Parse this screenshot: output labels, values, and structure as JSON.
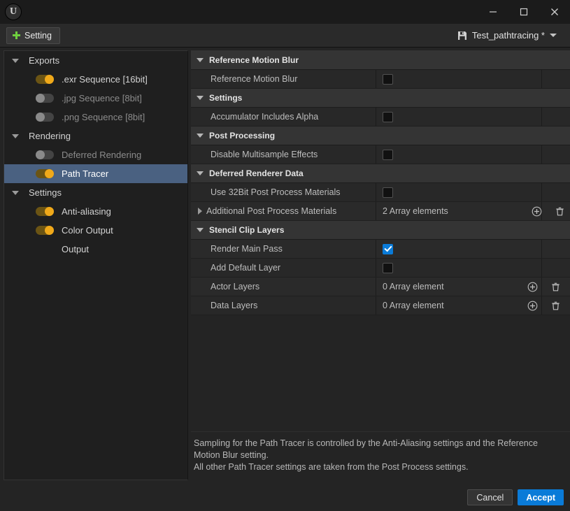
{
  "window": {
    "logo_glyph": "U",
    "minimize_label": "Minimize",
    "maximize_label": "Maximize",
    "close_label": "Close"
  },
  "toolbar": {
    "setting_button_label": "Setting",
    "preset_name": "Test_pathtracing *"
  },
  "sidebar": {
    "groups": [
      {
        "label": "Exports",
        "items": [
          {
            "label": ".exr Sequence [16bit]",
            "toggle": "on",
            "state": "enabled",
            "selected": false
          },
          {
            "label": ".jpg Sequence [8bit]",
            "toggle": "off",
            "state": "disabled",
            "selected": false
          },
          {
            "label": ".png Sequence [8bit]",
            "toggle": "off",
            "state": "disabled",
            "selected": false
          }
        ]
      },
      {
        "label": "Rendering",
        "items": [
          {
            "label": "Deferred Rendering",
            "toggle": "off",
            "state": "disabled",
            "selected": false
          },
          {
            "label": "Path Tracer",
            "toggle": "on",
            "state": "enabled",
            "selected": true
          }
        ]
      },
      {
        "label": "Settings",
        "items": [
          {
            "label": "Anti-aliasing",
            "toggle": "on",
            "state": "enabled",
            "selected": false
          },
          {
            "label": "Color Output",
            "toggle": "on",
            "state": "enabled",
            "selected": false
          },
          {
            "label": "Output",
            "toggle": "none",
            "state": "enabled",
            "selected": false
          }
        ]
      }
    ]
  },
  "details": {
    "sections": [
      {
        "category": "Reference Motion Blur",
        "rows": [
          {
            "label": "Reference Motion Blur",
            "type": "checkbox",
            "checked": false,
            "expandable": false
          }
        ]
      },
      {
        "category": "Settings",
        "rows": [
          {
            "label": "Accumulator Includes Alpha",
            "type": "checkbox",
            "checked": false,
            "expandable": false
          }
        ]
      },
      {
        "category": "Post Processing",
        "rows": [
          {
            "label": "Disable Multisample Effects",
            "type": "checkbox",
            "checked": false,
            "expandable": false
          }
        ]
      },
      {
        "category": "Deferred Renderer Data",
        "rows": [
          {
            "label": "Use 32Bit Post Process Materials",
            "type": "checkbox",
            "checked": false,
            "expandable": false
          },
          {
            "label": "Additional Post Process Materials",
            "type": "array",
            "value": "2 Array elements",
            "expandable": true,
            "add_label": "Add element",
            "delete_label": "Remove all elements"
          }
        ]
      },
      {
        "category": "Stencil Clip Layers",
        "rows": [
          {
            "label": "Render Main Pass",
            "type": "checkbox",
            "checked": true,
            "expandable": false
          },
          {
            "label": "Add Default Layer",
            "type": "checkbox",
            "checked": false,
            "expandable": false
          },
          {
            "label": "Actor Layers",
            "type": "array",
            "value": "0 Array element",
            "expandable": false,
            "add_label": "Add element",
            "delete_label": "Remove all elements"
          },
          {
            "label": "Data Layers",
            "type": "array",
            "value": "0 Array element",
            "expandable": false,
            "add_label": "Add element",
            "delete_label": "Remove all elements"
          }
        ]
      }
    ]
  },
  "description": {
    "line1": "Sampling for the Path Tracer is controlled by the Anti-Aliasing settings and the Reference",
    "line2": "Motion Blur setting.",
    "line3": "All other Path Tracer settings are taken from the Post Process settings."
  },
  "footer": {
    "cancel_label": "Cancel",
    "accept_label": "Accept"
  },
  "colors": {
    "accent_blue": "#0a7bd8",
    "toggle_on": "#f0a91a",
    "selection": "#4a6181",
    "plus_green": "#6fcf3f",
    "window_bg": "#242424"
  }
}
